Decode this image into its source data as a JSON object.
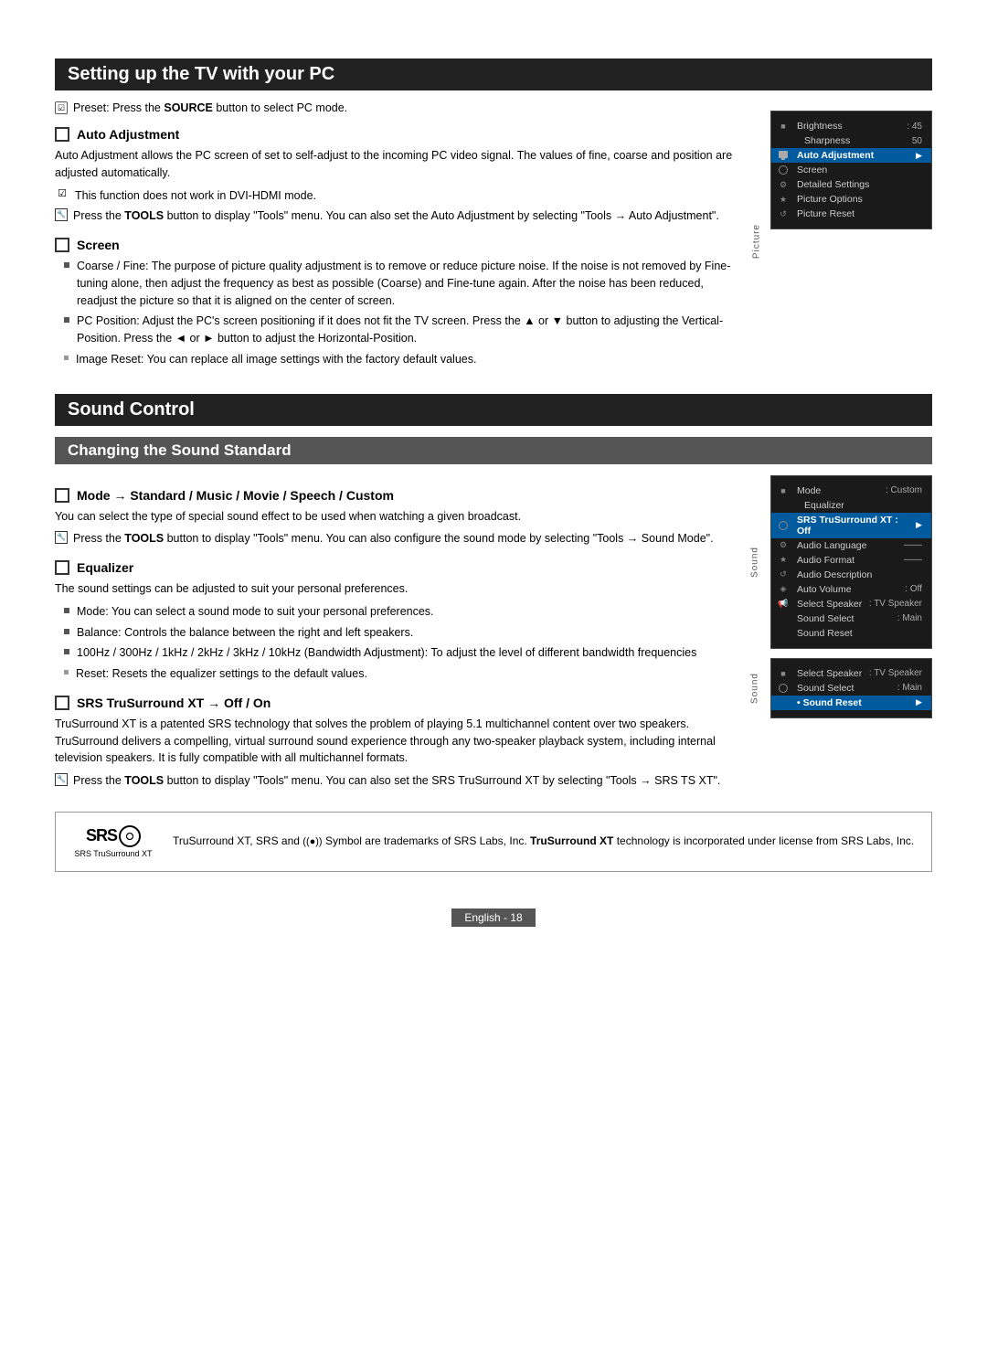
{
  "page": {
    "footer": "English - 18"
  },
  "section1": {
    "title": "Setting up the TV with your PC",
    "preset_label": "Preset: Press the ",
    "preset_bold": "SOURCE",
    "preset_rest": " button to select PC mode.",
    "subsections": [
      {
        "id": "auto-adjustment",
        "heading": "Auto Adjustment",
        "body": "Auto Adjustment allows the PC screen of set to self-adjust to the incoming PC video signal. The values of fine, coarse and position are adjusted automatically.",
        "notes": [
          {
            "icon": "check",
            "text": "This function does not work in DVI-HDMI mode."
          },
          {
            "icon": "tools",
            "text_pre": "Press the ",
            "text_bold": "TOOLS",
            "text_rest": " button to display \"Tools\" menu. You can also set the Auto Adjustment by selecting \"Tools → Auto Adjustment\"."
          }
        ]
      },
      {
        "id": "screen",
        "heading": "Screen",
        "bullets": [
          "Coarse / Fine: The purpose of picture quality adjustment is to remove or reduce picture noise. If the noise is not removed by Fine-tuning alone, then adjust the frequency as best as possible (Coarse) and Fine-tune again. After the noise has been reduced, readjust the picture so that it is aligned on the center of screen.",
          "PC Position: Adjust the PC's screen positioning if it does not fit the TV screen. Press the ▲ or ▼ button to adjusting the Vertical-Position. Press the ◄ or ► button to adjust the Horizontal-Position.",
          "Image Reset: You can replace all image settings with the factory default values."
        ]
      }
    ]
  },
  "section2": {
    "title": "Sound Control"
  },
  "section3": {
    "title": "Changing the Sound Standard",
    "subsections": [
      {
        "id": "mode",
        "heading": "Mode → Standard / Music / Movie / Speech / Custom",
        "body": "You can select the type of special sound effect to be used when watching a given broadcast.",
        "notes": [
          {
            "icon": "tools",
            "text_pre": "Press the ",
            "text_bold": "TOOLS",
            "text_rest": " button to display \"Tools\" menu. You can also configure the sound mode by selecting \"Tools → Sound Mode\"."
          }
        ]
      },
      {
        "id": "equalizer",
        "heading": "Equalizer",
        "body": "The sound settings can be adjusted to suit your personal preferences.",
        "bullets": [
          "Mode: You can select a sound mode to suit your personal preferences.",
          "Balance: Controls the balance between the right and left speakers.",
          "100Hz / 300Hz / 1kHz / 2kHz / 3kHz / 10kHz (Bandwidth Adjustment): To adjust the level of different bandwidth frequencies",
          "Reset: Resets the equalizer settings to the default values."
        ]
      },
      {
        "id": "srs",
        "heading": "SRS TruSurround XT → Off / On",
        "body": "TruSurround XT is a patented SRS technology that solves the problem of playing 5.1 multichannel content over two speakers. TruSurround delivers a compelling, virtual surround sound experience through any two-speaker playback system, including internal television speakers. It is fully compatible with all multichannel formats.",
        "notes": [
          {
            "icon": "tools",
            "text_pre": "Press the ",
            "text_bold": "TOOLS",
            "text_rest": " button to display \"Tools\" menu. You can also set the SRS TruSurround XT by selecting \"Tools → SRS TS XT\"."
          }
        ]
      }
    ]
  },
  "tv_panel1": {
    "label": "Picture",
    "rows": [
      {
        "label": "Brightness",
        "value": ": 45",
        "highlighted": false
      },
      {
        "label": "Sharpness",
        "value": "50",
        "highlighted": false
      },
      {
        "label": "Auto Adjustment",
        "value": "",
        "highlighted": true,
        "arrow": true
      },
      {
        "label": "Screen",
        "value": "",
        "highlighted": false
      },
      {
        "label": "Detailed Settings",
        "value": "",
        "highlighted": false
      },
      {
        "label": "Picture Options",
        "value": "",
        "highlighted": false
      },
      {
        "label": "Picture Reset",
        "value": "",
        "highlighted": false
      }
    ],
    "icons": [
      "picture",
      "empty",
      "picture",
      "circle",
      "settings",
      "star",
      "arrow",
      "speaker"
    ]
  },
  "tv_panel2": {
    "label": "Sound",
    "rows": [
      {
        "label": "Mode",
        "value": ": Custom",
        "highlighted": false
      },
      {
        "label": "Equalizer",
        "value": "",
        "highlighted": false
      },
      {
        "label": "SRS TruSurround XT : Off",
        "value": "",
        "highlighted": true,
        "arrow": true
      },
      {
        "label": "Audio Language",
        "value": "——",
        "highlighted": false
      },
      {
        "label": "Audio Format",
        "value": "——",
        "highlighted": false
      },
      {
        "label": "Audio Description",
        "value": "",
        "highlighted": false
      },
      {
        "label": "Auto Volume",
        "value": ": Off",
        "highlighted": false
      },
      {
        "label": "Select Speaker",
        "value": ": TV Speaker",
        "highlighted": false
      },
      {
        "label": "Sound Select",
        "value": ": Main",
        "highlighted": false
      },
      {
        "label": "Sound Reset",
        "value": "",
        "highlighted": false
      }
    ]
  },
  "tv_panel3": {
    "label": "Sound",
    "rows": [
      {
        "label": "Select Speaker",
        "value": ": TV Speaker",
        "highlighted": false
      },
      {
        "label": "Sound Select",
        "value": ": Main",
        "highlighted": false
      },
      {
        "label": "Sound Reset",
        "value": "",
        "highlighted": true,
        "arrow": true
      }
    ]
  },
  "srs_box": {
    "logo_text": "SRS",
    "logo_sub": "SRS TruSurround XT",
    "desc_pre": "TruSurround XT, SRS and ",
    "desc_symbol": "((•))",
    "desc_mid": " Symbol are trademarks of SRS Labs, Inc. ",
    "desc_bold": "TruSurround XT",
    "desc_rest": " technology is incorporated under license from SRS Labs, Inc."
  }
}
